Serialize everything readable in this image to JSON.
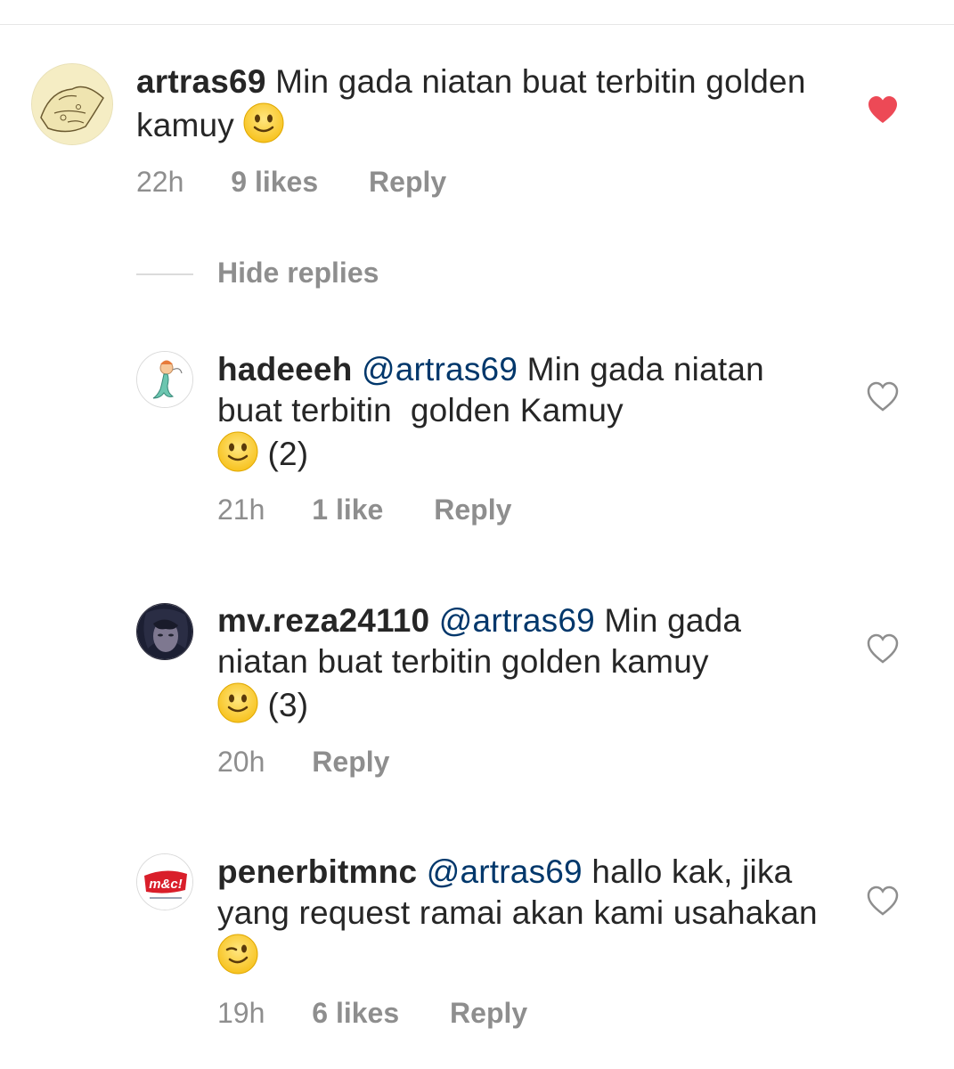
{
  "comments": [
    {
      "username": "artras69",
      "mention": "",
      "text": "Min gada niatan buat terbitin golden kamuy",
      "emoji": "slightly-smiling-face",
      "suffix": "",
      "time": "22h",
      "likes": "9 likes",
      "reply": "Reply",
      "liked": true
    },
    {
      "username": "hadeeeh",
      "mention": "@artras69",
      "text": "Min gada niatan buat terbitin  golden Kamuy",
      "emoji": "slightly-smiling-face",
      "suffix": "(2)",
      "time": "21h",
      "likes": "1 like",
      "reply": "Reply",
      "liked": false
    },
    {
      "username": "mv.reza24110",
      "mention": "@artras69",
      "text": "Min gada niatan buat terbitin golden kamuy",
      "emoji": "slightly-smiling-face",
      "suffix": "(3)",
      "time": "20h",
      "likes": "",
      "reply": "Reply",
      "liked": false
    },
    {
      "username": "penerbitmnc",
      "mention": "@artras69",
      "text": "hallo kak, jika yang request ramai akan kami usahakan",
      "emoji": "winking-face",
      "suffix": "",
      "time": "19h",
      "likes": "6 likes",
      "reply": "Reply",
      "liked": false
    }
  ],
  "hide_replies_label": "Hide replies",
  "colors": {
    "heart_liked": "#ed4956",
    "meta_gray": "#8e8e8e",
    "mention_blue": "#00376b"
  },
  "icons": {
    "like": "heart-icon",
    "emoji_smile": "slightly-smiling-face",
    "emoji_wink": "winking-face"
  },
  "logo_text": "m&c!"
}
